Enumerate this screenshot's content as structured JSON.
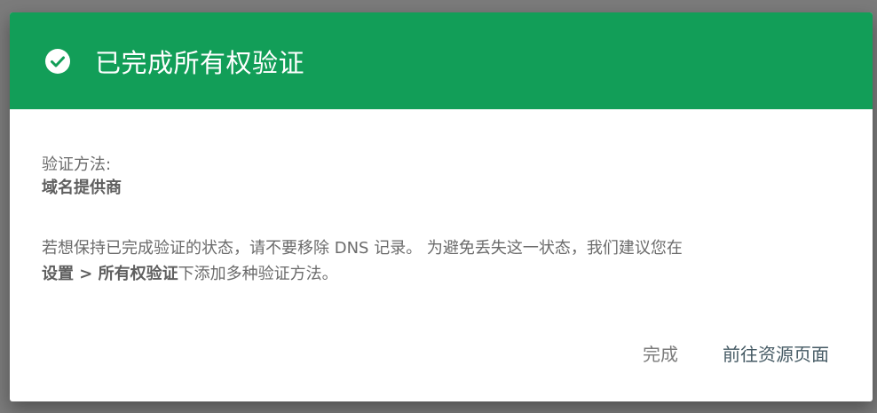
{
  "dialog": {
    "title": "已完成所有权验证",
    "method_label": "验证方法:",
    "method_value": "域名提供商",
    "description_part1": "若想保持已完成验证的状态，请不要移除 DNS 记录。 为避免丢失这一状态，我们建议您在",
    "description_bold": "设置 > 所有权验证",
    "description_part2": "下添加多种验证方法。",
    "done_button": "完成",
    "go_button": "前往资源页面"
  },
  "colors": {
    "header_green": "#129e58",
    "backdrop": "#7b7b7b"
  },
  "icons": {
    "header_icon": "check-circle-icon"
  }
}
